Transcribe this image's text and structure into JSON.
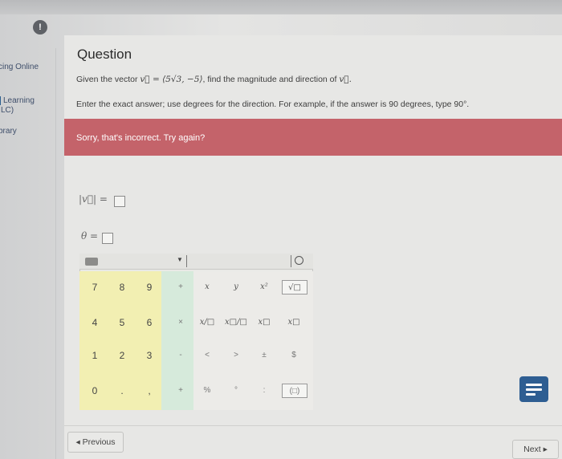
{
  "sidebar": {
    "items": [
      {
        "label": "cing Online"
      },
      {
        "label": "Learning"
      },
      {
        "label": "LC)"
      },
      {
        "label": "brary"
      }
    ]
  },
  "question": {
    "title": "Question",
    "line1_prefix": "Given the vector ",
    "line1_math": "v⃗ = ⟨5√3, −5⟩",
    "line1_suffix": ", find the magnitude and direction of ",
    "line1_end": "v⃗.",
    "line2": "Enter the exact answer; use degrees for the direction. For example, if the answer is 90 degrees, type 90°."
  },
  "feedback": {
    "message": "Sorry, that's incorrect. Try again?",
    "color": "#c4636a"
  },
  "answers": {
    "magnitude_label": "|v⃗| =",
    "angle_label": "θ ="
  },
  "keypad": {
    "numbers": [
      "7",
      "8",
      "9",
      "4",
      "5",
      "6",
      "1",
      "2",
      "3",
      "0",
      ".",
      ","
    ],
    "ops": [
      "+",
      "×",
      "-",
      "+"
    ],
    "functions": [
      "x",
      "y",
      "x²",
      "√□",
      "x/□",
      "x□/□",
      "x□",
      "x□",
      "<",
      ">",
      "±",
      "$",
      "%",
      "°",
      ":",
      "(□)"
    ]
  },
  "nav": {
    "previous": "◂ Previous",
    "next": "Next ▸"
  },
  "colors": {
    "accent": "#2e5e92",
    "numpad": "#f2efb2",
    "opspad": "#d6eadb"
  }
}
